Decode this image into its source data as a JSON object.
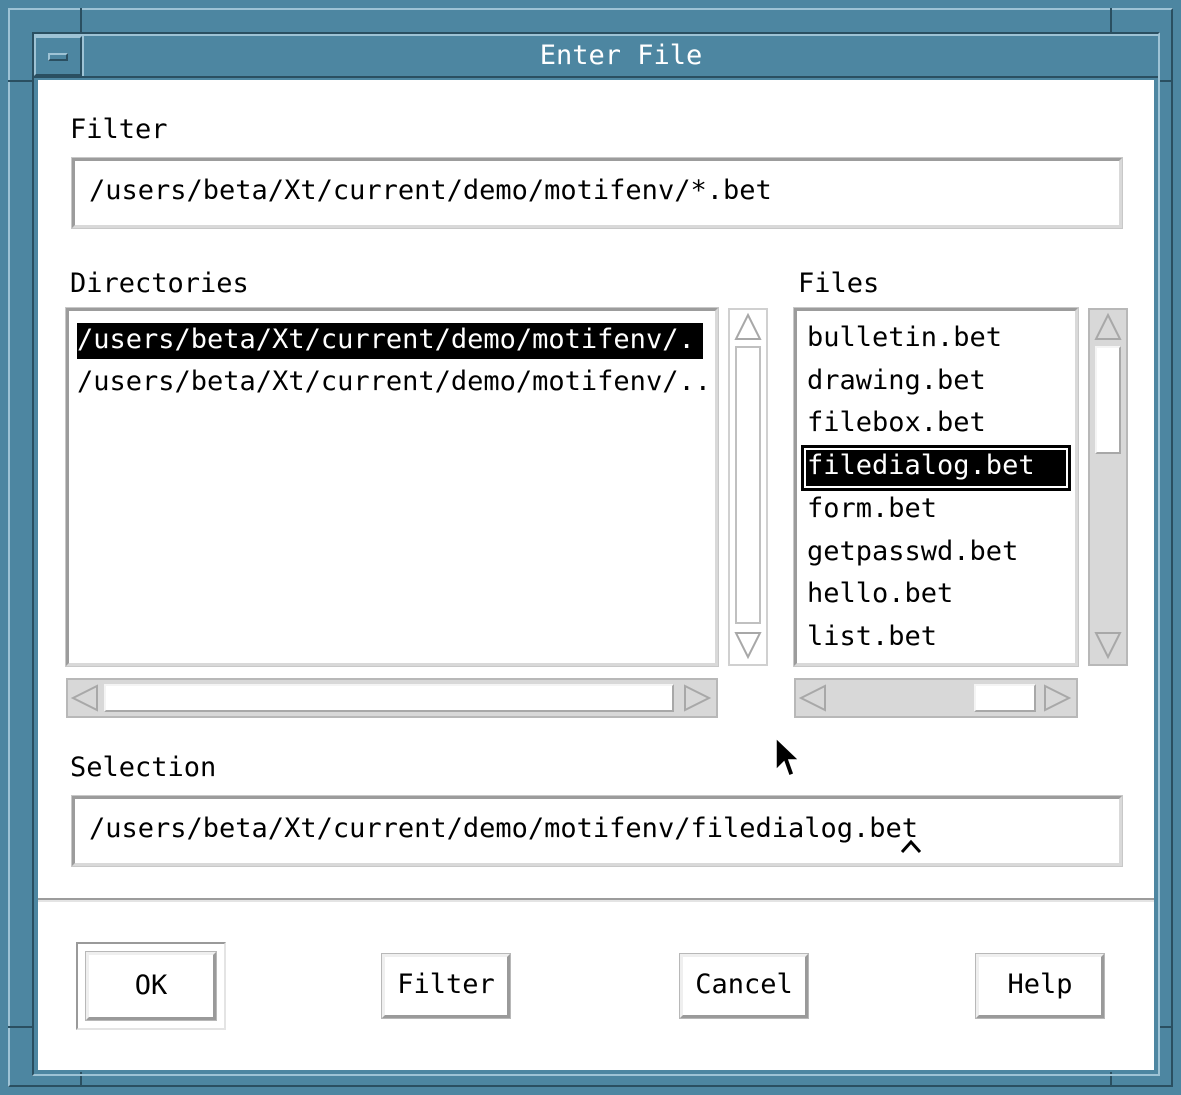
{
  "window": {
    "title": "Enter File",
    "frame_color": "#4d86a1"
  },
  "filter": {
    "label": "Filter",
    "value": "/users/beta/Xt/current/demo/motifenv/*.bet"
  },
  "directories": {
    "label": "Directories",
    "items": [
      "/users/beta/Xt/current/demo/motifenv/.",
      "/users/beta/Xt/current/demo/motifenv/.."
    ],
    "selected_index": 0
  },
  "files": {
    "label": "Files",
    "items": [
      "bulletin.bet",
      "drawing.bet",
      "filebox.bet",
      "filedialog.bet",
      "form.bet",
      "getpasswd.bet",
      "hello.bet",
      "list.bet"
    ],
    "selected_index": 3
  },
  "selection": {
    "label": "Selection",
    "value": "/users/beta/Xt/current/demo/motifenv/filedialog.bet"
  },
  "buttons": {
    "ok": "OK",
    "filter": "Filter",
    "cancel": "Cancel",
    "help": "Help"
  },
  "icons": {
    "window_menu": "window-menu-icon",
    "mouse_pointer": "mouse-pointer-icon",
    "text_caret": "text-caret-icon"
  }
}
